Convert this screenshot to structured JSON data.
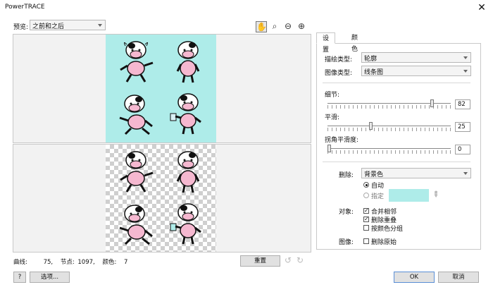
{
  "window": {
    "title": "PowerTRACE"
  },
  "preview": {
    "label": "预览:",
    "mode": "之前和之后"
  },
  "status": {
    "curves_label": "曲线:",
    "curves": "75,",
    "nodes_label": "节点:",
    "nodes": "1097,",
    "colors_label": "颜色:",
    "colors": "7"
  },
  "buttons": {
    "reset": "重置",
    "help": "?",
    "options": "选项...",
    "ok": "OK",
    "cancel": "取消"
  },
  "tabs": [
    "设置",
    "颜色"
  ],
  "settings": {
    "trace_type_label": "描绘类型:",
    "trace_type": "轮廓",
    "image_type_label": "图像类型:",
    "image_type": "线条图",
    "detail_label": "细节:",
    "detail_value": "82",
    "smoothing_label": "平滑:",
    "smoothing_value": "25",
    "corner_label": "拐角平滑度:",
    "corner_value": "0",
    "delete_label": "删除:",
    "delete_value": "背景色",
    "radio_auto": "自动",
    "radio_specify": "指定",
    "specify_color": "#aeece9",
    "object_label": "对象:",
    "merge_adjacent": "合并相邻",
    "remove_overlap": "删除重叠",
    "group_by_color": "按颜色分组",
    "image_label": "图像:",
    "delete_original": "删除原始"
  },
  "slider_levels": {
    "detail": 0.86,
    "smoothing": 0.35,
    "corner": 0.0
  },
  "colors": {
    "preview_bg": "#aeece9",
    "cow_pink": "#f5b8d0"
  }
}
